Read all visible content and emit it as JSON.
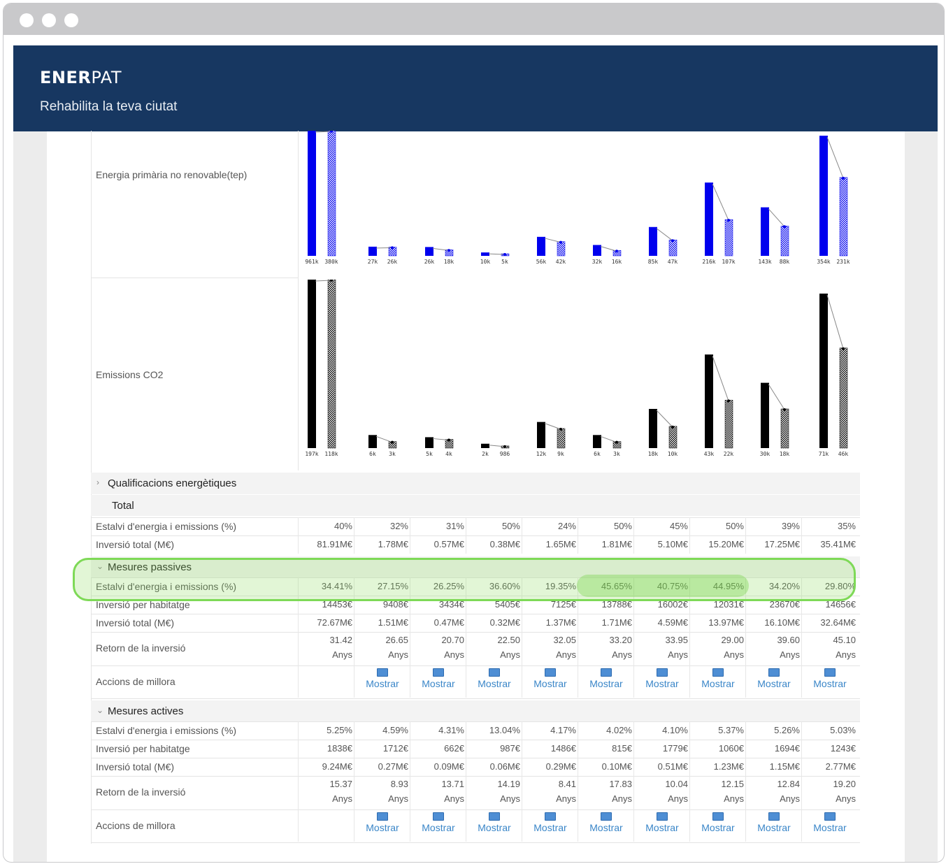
{
  "app": {
    "brand_bold": "ENER",
    "brand_light": "PAT",
    "subtitle": "Rehabilita la teva ciutat"
  },
  "colors": {
    "header": "#173761",
    "energy_bar": "#0000ee",
    "co2_bar": "#000000",
    "highlight": "#7ed957",
    "link": "#3a86c8"
  },
  "charts": {
    "energy_label": "Energia primària no renovable(tep)",
    "co2_label": "Emissions CO2"
  },
  "chart_data": [
    {
      "type": "bar",
      "series": [
        {
          "name": "",
          "labels": [
            "961k",
            "27k",
            "26k",
            "10k",
            "56k",
            "32k",
            "85k",
            "216k",
            "143k",
            "354k"
          ]
        },
        {
          "name": "",
          "labels": [
            "380k",
            "26k",
            "18k",
            "5k",
            "42k",
            "16k",
            "47k",
            "107k",
            "88k",
            "231k"
          ]
        }
      ],
      "values_before": [
        961,
        27,
        26,
        10,
        56,
        32,
        85,
        216,
        143,
        354
      ],
      "values_after": [
        380,
        26,
        18,
        5,
        42,
        16,
        47,
        107,
        88,
        231
      ]
    },
    {
      "type": "bar",
      "labels_before": [
        "197k",
        "6k",
        "5k",
        "2k",
        "12k",
        "6k",
        "18k",
        "43k",
        "30k",
        "71k"
      ],
      "labels_after": [
        "118k",
        "3k",
        "4k",
        "986",
        "9k",
        "3k",
        "10k",
        "22k",
        "18k",
        "46k"
      ],
      "values_before": [
        197,
        6,
        5,
        2,
        12,
        6,
        18,
        43,
        30,
        71
      ],
      "values_after": [
        118,
        3,
        4,
        0.986,
        9,
        3,
        10,
        22,
        18,
        46
      ]
    }
  ],
  "sections": {
    "qualificacions": {
      "label": "Qualificacions energètiques",
      "chevron": "›"
    },
    "total": {
      "label": "Total",
      "rows": [
        {
          "label": "Estalvi d'energia i emissions (%)",
          "values": [
            "40%",
            "32%",
            "31%",
            "50%",
            "24%",
            "50%",
            "45%",
            "50%",
            "39%",
            "35%"
          ]
        },
        {
          "label": "Inversió total (M€)",
          "values": [
            "81.91M€",
            "1.78M€",
            "0.57M€",
            "0.38M€",
            "1.65M€",
            "1.81M€",
            "5.10M€",
            "15.20M€",
            "17.25M€",
            "35.41M€"
          ]
        }
      ]
    },
    "passives": {
      "label": "Mesures passives",
      "chevron": "⌄",
      "rows": [
        {
          "label": "Estalvi d'energia i emissions (%)",
          "values": [
            "34.41%",
            "27.15%",
            "26.25%",
            "36.60%",
            "19.35%",
            "45.65%",
            "40.75%",
            "44.95%",
            "34.20%",
            "29.80%"
          ]
        },
        {
          "label": "Inversió per habitatge",
          "values": [
            "14453€",
            "9408€",
            "3434€",
            "5405€",
            "7125€",
            "13788€",
            "16002€",
            "12031€",
            "23670€",
            "14656€"
          ]
        },
        {
          "label": "Inversió total (M€)",
          "values": [
            "72.67M€",
            "1.51M€",
            "0.47M€",
            "0.32M€",
            "1.37M€",
            "1.71M€",
            "4.59M€",
            "13.97M€",
            "16.10M€",
            "32.64M€"
          ]
        }
      ],
      "retorn": {
        "label": "Retorn de la inversió",
        "values": [
          "31.42",
          "26.65",
          "20.70",
          "22.50",
          "32.05",
          "33.20",
          "33.95",
          "29.00",
          "39.60",
          "45.10"
        ],
        "unit": "Anys"
      },
      "accions": {
        "label": "Accions de millora",
        "link": "Mostrar"
      }
    },
    "actives": {
      "label": "Mesures actives",
      "chevron": "⌄",
      "rows": [
        {
          "label": "Estalvi d'energia i emissions (%)",
          "values": [
            "5.25%",
            "4.59%",
            "4.31%",
            "13.04%",
            "4.17%",
            "4.02%",
            "4.10%",
            "5.37%",
            "5.26%",
            "5.03%"
          ]
        },
        {
          "label": "Inversió per habitatge",
          "values": [
            "1838€",
            "1712€",
            "662€",
            "987€",
            "1486€",
            "815€",
            "1779€",
            "1060€",
            "1694€",
            "1243€"
          ]
        },
        {
          "label": "Inversió total (M€)",
          "values": [
            "9.24M€",
            "0.27M€",
            "0.09M€",
            "0.06M€",
            "0.29M€",
            "0.10M€",
            "0.51M€",
            "1.23M€",
            "1.15M€",
            "2.77M€"
          ]
        }
      ],
      "retorn": {
        "label": "Retorn de la inversió",
        "values": [
          "15.37",
          "8.93",
          "13.71",
          "14.19",
          "8.41",
          "17.83",
          "10.04",
          "12.15",
          "12.84",
          "19.20"
        ],
        "unit": "Anys"
      },
      "accions": {
        "label": "Accions de millora",
        "link": "Mostrar"
      }
    }
  }
}
